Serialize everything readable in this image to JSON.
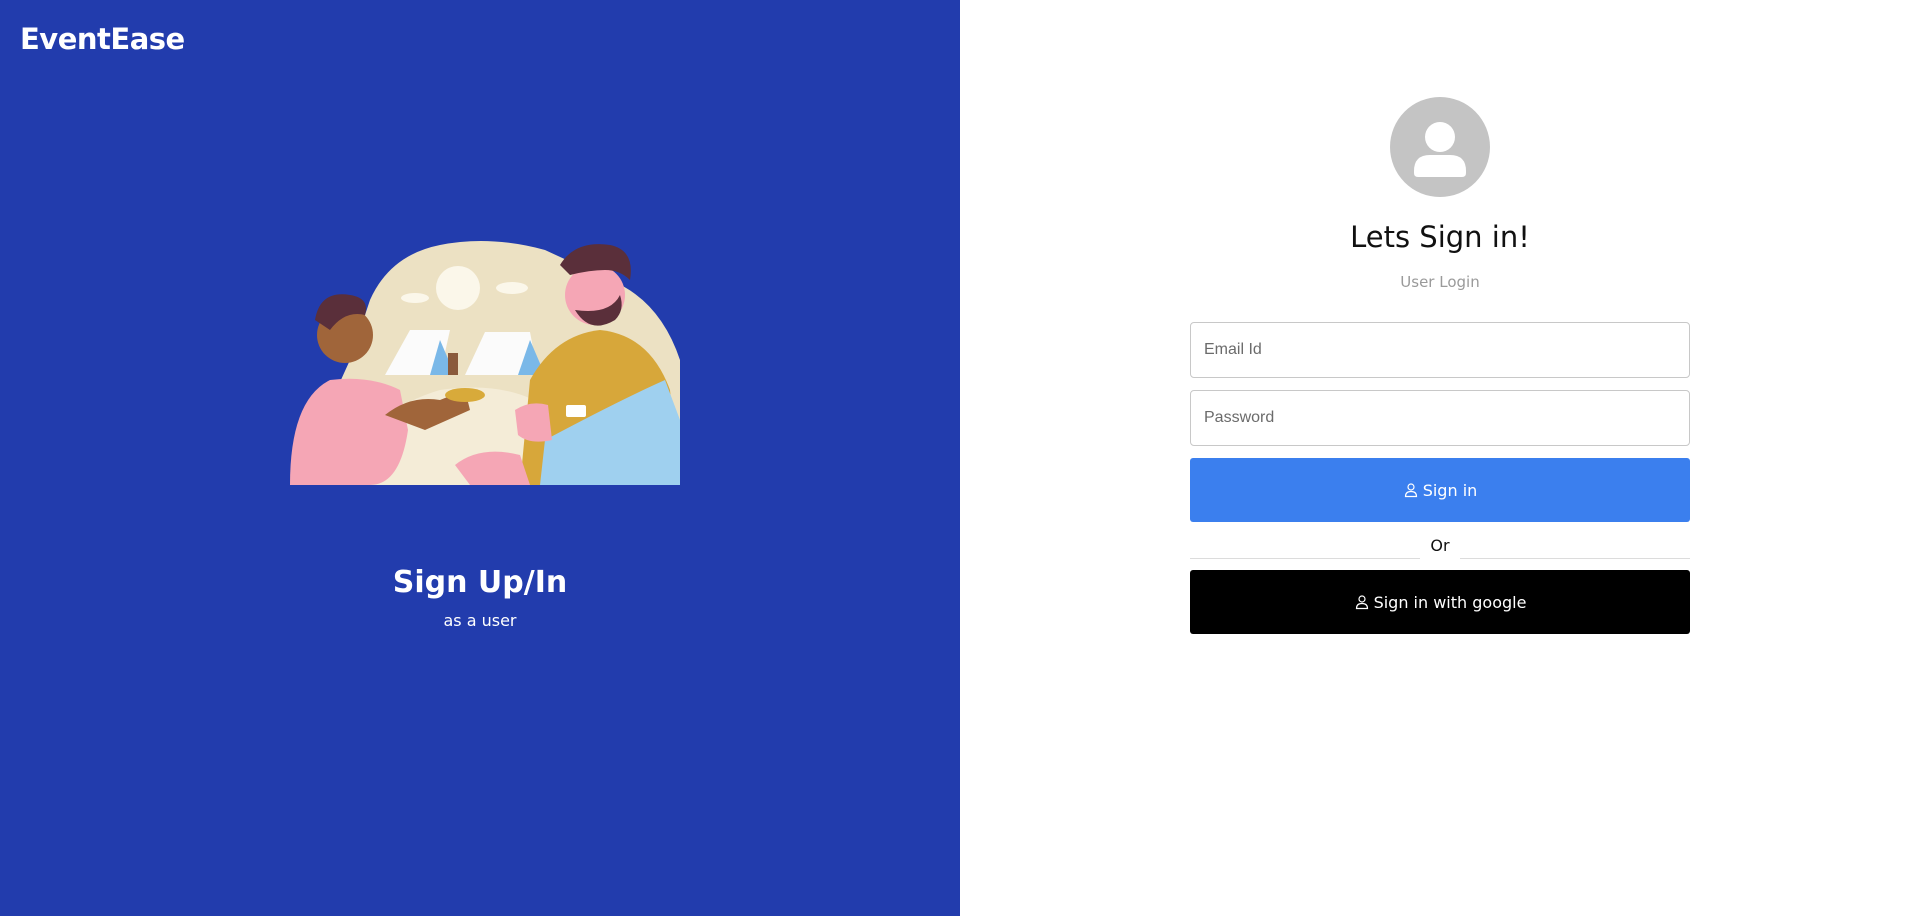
{
  "brand": {
    "name": "EventEase"
  },
  "left": {
    "title": "Sign Up/In",
    "subtitle": "as a user",
    "illustration": "two-people-camping-illustration"
  },
  "login": {
    "avatar_icon": "user-icon",
    "title": "Lets Sign in!",
    "subtitle": "User Login",
    "email": {
      "placeholder": "Email Id",
      "value": ""
    },
    "password": {
      "placeholder": "Password",
      "value": ""
    },
    "signin_label": "Sign in",
    "divider_text": "Or",
    "google_label": "Sign in with google"
  },
  "colors": {
    "left_panel_bg": "#223cad",
    "signin_button": "#3b7fee",
    "google_button": "#000000",
    "avatar_bg": "#c4c4c4"
  }
}
